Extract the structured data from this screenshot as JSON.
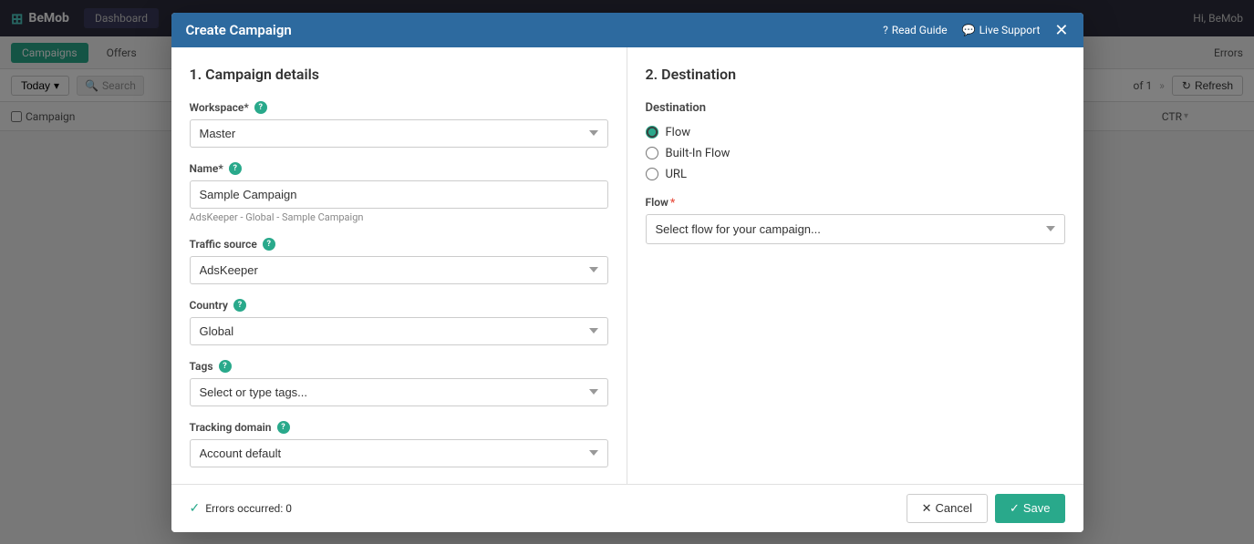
{
  "topbar": {
    "logo": "BeMob",
    "logo_icon": "⊞",
    "tabs": [
      {
        "label": "Dashboard",
        "active": false
      }
    ],
    "actions": [
      {
        "label": "Read Guide",
        "icon": "?"
      },
      {
        "label": "Live Support",
        "icon": "💬"
      }
    ],
    "user": "Hi, BeMob",
    "close_icon": "✕"
  },
  "secondbar": {
    "tabs": [
      {
        "label": "Campaigns",
        "active": true
      },
      {
        "label": "Offers",
        "active": false
      }
    ],
    "right_tabs": [
      {
        "label": "Errors"
      }
    ]
  },
  "tablebar": {
    "today_label": "Today",
    "today_chevron": "▾",
    "search_placeholder": "Search",
    "pagination": "of 1",
    "refresh_label": "Refresh",
    "refresh_icon": "↻"
  },
  "table_columns": {
    "campaign": "Campaign",
    "ctr": "CTR"
  },
  "modal": {
    "title": "Create Campaign",
    "read_guide": "Read Guide",
    "live_support": "Live Support",
    "close_icon": "✕",
    "left_panel": {
      "title": "1. Campaign details",
      "fields": {
        "workspace": {
          "label": "Workspace*",
          "help": true,
          "value": "Master",
          "options": [
            "Master"
          ]
        },
        "name": {
          "label": "Name*",
          "help": true,
          "value": "Sample Campaign",
          "hint": "AdsKeeper - Global - Sample Campaign"
        },
        "traffic_source": {
          "label": "Traffic source",
          "help": true,
          "value": "AdsKeeper",
          "options": [
            "AdsKeeper"
          ]
        },
        "country": {
          "label": "Country",
          "help": true,
          "value": "Global",
          "options": [
            "Global"
          ]
        },
        "tags": {
          "label": "Tags",
          "help": true,
          "placeholder": "Select or type tags...",
          "value": ""
        },
        "tracking_domain": {
          "label": "Tracking domain",
          "help": true,
          "value": "Account default",
          "options": [
            "Account default"
          ]
        }
      }
    },
    "right_panel": {
      "title": "2. Destination",
      "destination_label": "Destination",
      "radio_options": [
        {
          "label": "Flow",
          "value": "flow",
          "checked": true
        },
        {
          "label": "Built-In Flow",
          "value": "builtin",
          "checked": false
        },
        {
          "label": "URL",
          "value": "url",
          "checked": false
        }
      ],
      "flow_label": "Flow",
      "flow_required": true,
      "flow_placeholder": "Select flow for your campaign..."
    },
    "footer": {
      "errors_label": "Errors occurred: 0",
      "cancel_label": "Cancel",
      "save_label": "Save",
      "cancel_icon": "✕",
      "save_icon": "✓"
    }
  }
}
